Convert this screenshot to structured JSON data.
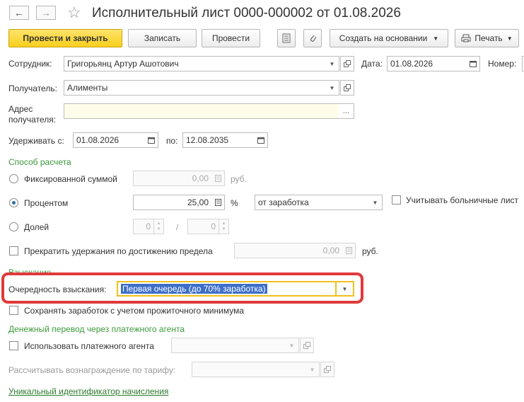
{
  "header": {
    "title": "Исполнительный лист 0000-000002 от 01.08.2026",
    "nav_back": "←",
    "nav_forward": "→",
    "star": "☆"
  },
  "toolbar": {
    "post_close": "Провести и закрыть",
    "save": "Записать",
    "post": "Провести",
    "create_based": "Создать на основании",
    "print": "Печать"
  },
  "form": {
    "employee_label": "Сотрудник:",
    "employee_value": "Григорьянц Артур Ашотович",
    "date_label": "Дата:",
    "date_value": "01.08.2026",
    "number_label": "Номер:",
    "number_value": "",
    "recipient_label": "Получатель:",
    "recipient_value": "Алименты",
    "address_label_1": "Адрес",
    "address_label_2": "получателя:",
    "address_value": "",
    "address_btn": "...",
    "withhold_from_label": "Удерживать с:",
    "withhold_from_value": "01.08.2026",
    "withhold_to_label": "по:",
    "withhold_to_value": "12.08.2035"
  },
  "calc_method": {
    "section_title": "Способ расчета",
    "fixed_label": "Фиксированной суммой",
    "fixed_value": "0,00",
    "fixed_unit": "руб.",
    "percent_label": "Процентом",
    "percent_value": "25,00",
    "percent_unit": "%",
    "base_value": "от заработка",
    "sick_leave_label": "Учитывать больничные лист",
    "share_label": "Долей",
    "share_num": "0",
    "share_slash": "/",
    "share_den": "0",
    "limit_label": "Прекратить удержания по достижению предела",
    "limit_value": "0,00",
    "limit_unit": "руб."
  },
  "collection": {
    "section_title": "Взыскание",
    "priority_label": "Очередность взыскания:",
    "priority_value": "Первая очередь (до 70% заработка)",
    "keep_minimum_label": "Сохранять заработок с учетом прожиточного минимума"
  },
  "payment_agent": {
    "section_title": "Денежный перевод через платежного агента",
    "use_agent_label": "Использовать платежного агента",
    "tariff_label": "Рассчитывать вознаграждение по тарифу:",
    "uid_link": "Уникальный идентификатор начисления"
  },
  "colors": {
    "primary_button": "#f7cf1d",
    "section_green": "#3b9a3b",
    "highlight_red": "#e03a3a",
    "selection_blue": "#3d6fc9"
  }
}
